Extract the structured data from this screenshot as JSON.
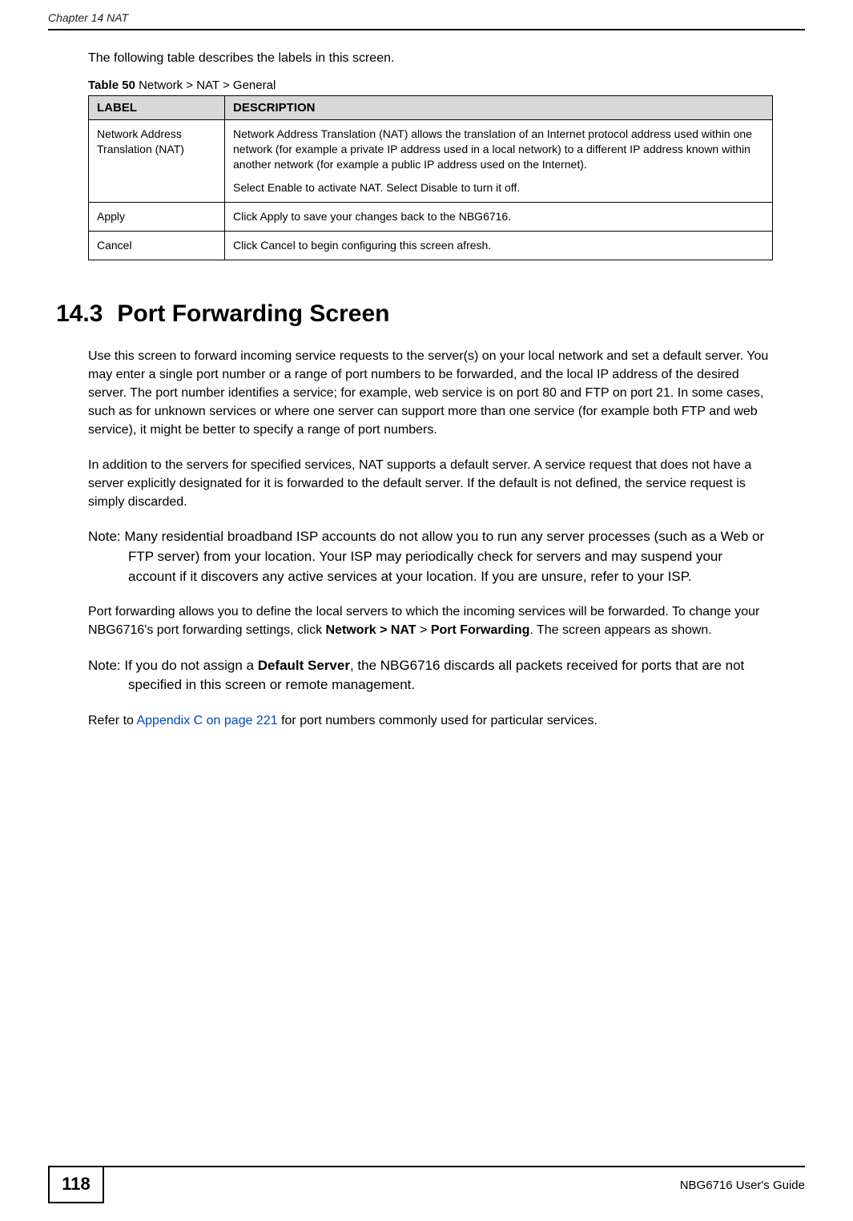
{
  "header": {
    "chapter": "Chapter 14 NAT"
  },
  "intro": "The following table describes the labels in this screen.",
  "table": {
    "caption_prefix": "Table 50",
    "caption_rest": "   Network > NAT > General",
    "head": {
      "label": "LABEL",
      "description": "DESCRIPTION"
    },
    "rows": [
      {
        "label": "Network Address Translation (NAT)",
        "desc_p1": "Network Address Translation (NAT) allows the translation of an Internet protocol address used within one network (for example a private IP address used in a local network) to a different IP address known within another network (for example a public IP address used on the Internet).",
        "desc_p2a": "Select ",
        "desc_p2b": "Enable",
        "desc_p2c": " to activate NAT. Select ",
        "desc_p2d": "Disable",
        "desc_p2e": " to turn it off."
      },
      {
        "label": "Apply",
        "desc_a": "Click ",
        "desc_b": "Apply",
        "desc_c": " to save your changes back to the NBG6716."
      },
      {
        "label": "Cancel",
        "desc_a": "Click ",
        "desc_b": "Cancel",
        "desc_c": " to begin configuring this screen afresh."
      }
    ]
  },
  "section": {
    "number": "14.3",
    "title": "Port Forwarding Screen"
  },
  "para1": "Use this screen to forward incoming service requests to the server(s) on your local network and set a default server. You may enter a single port number or a range of port numbers to be forwarded, and the local IP address of the desired server. The port number identifies a service; for example, web service is on port 80 and FTP on port 21. In some cases, such as for unknown services or where one server can support more than one service (for example both FTP and web service), it might be better to specify a range of port numbers.",
  "para2": "In addition to the servers for specified services, NAT supports a default server. A service request that does not have a server explicitly designated for it is forwarded to the default server. If the default is not defined, the service request is simply discarded.",
  "note1": "Note: Many residential broadband ISP accounts do not allow you to run any server processes (such as a Web or FTP server) from your location. Your ISP may periodically check for servers and may suspend your account if it discovers any active services at your location. If you are unsure, refer to your ISP.",
  "para3a": "Port forwarding allows you to define the local servers to which the incoming services will be forwarded. To change your NBG6716's port forwarding settings, click ",
  "para3b": "Network > NAT",
  "para3c": " > ",
  "para3d": "Port Forwarding",
  "para3e": ". The screen appears as shown.",
  "note2a": "Note: If you do not assign a ",
  "note2b": "Default Server",
  "note2c": ", the NBG6716 discards all packets received for ports that are not specified in this screen or remote management.",
  "para4a": "Refer to ",
  "para4b": "Appendix C on page 221",
  "para4c": " for port numbers commonly used for particular services.",
  "footer": {
    "page": "118",
    "guide": "NBG6716 User's Guide"
  }
}
